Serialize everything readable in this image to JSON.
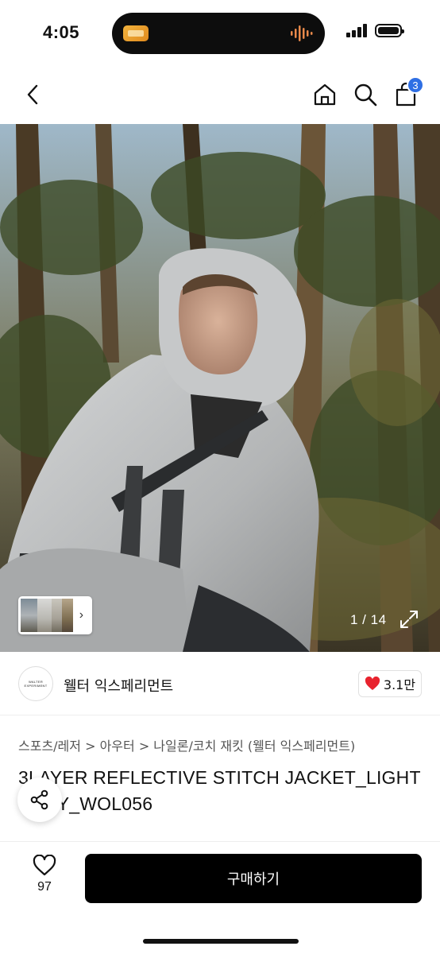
{
  "status_bar": {
    "time": "4:05",
    "icons": [
      "activity-app-icon",
      "audio-wave-icon",
      "cellular-signal-icon",
      "battery-icon"
    ]
  },
  "nav": {
    "icons": [
      "back-chevron-icon",
      "home-icon",
      "search-icon",
      "cart-icon"
    ],
    "cart_count": "3"
  },
  "gallery": {
    "counter": "1 / 14",
    "icons": [
      "expand-icon",
      "chevron-right-icon"
    ]
  },
  "store": {
    "logo_text": "WALTER EXPERIMENT",
    "name": "웰터 익스페리먼트",
    "likes": "3.1만",
    "heart_color": "#e8232e"
  },
  "product": {
    "category": "스포츠/레저 > 아우터 > 나일론/코치 재킷 (웰터 익스페리먼트)",
    "title": "3LAYER REFLECTIVE STITCH JACKET_LIGHT GRAY_WOL056"
  },
  "bottom_bar": {
    "wish_count": "97",
    "buy_label": "구매하기",
    "buy_color": "#000000"
  },
  "colors": {
    "badge": "#2f6fe4",
    "heart": "#e8232e"
  }
}
